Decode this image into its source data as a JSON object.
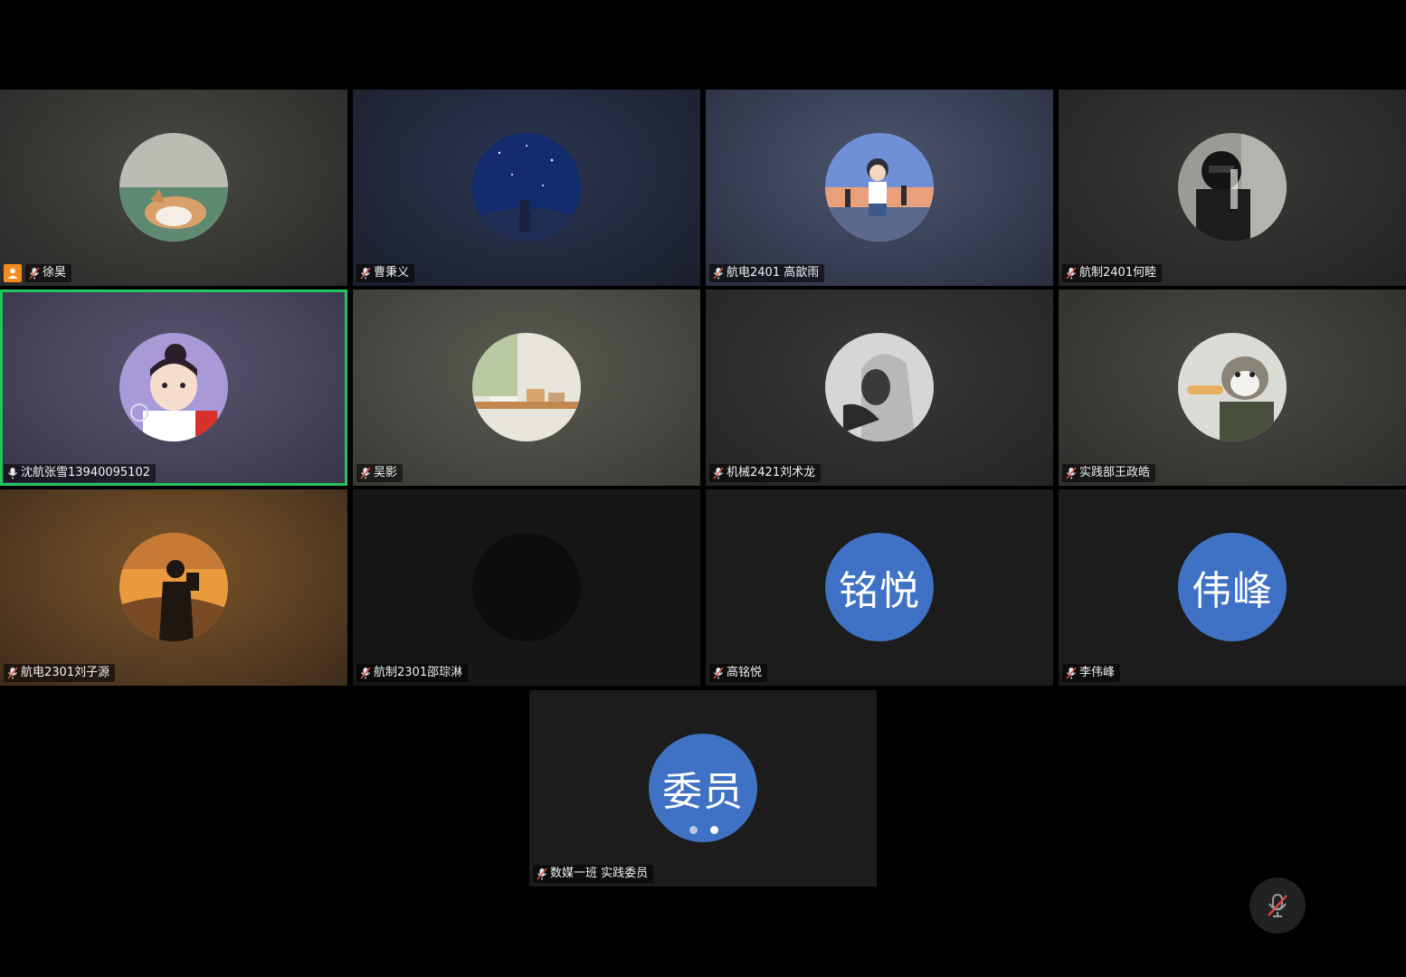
{
  "participants": [
    {
      "name": "徐昊",
      "host": true,
      "muted": true,
      "active": false
    },
    {
      "name": "曹秉义",
      "muted": true,
      "active": false
    },
    {
      "name": "航电2401 高歆雨",
      "muted": true,
      "active": false
    },
    {
      "name": "航制2401何睦",
      "muted": true,
      "active": false
    },
    {
      "name": "沈航张雪13940095102",
      "muted": false,
      "active": true
    },
    {
      "name": "吴影",
      "muted": true,
      "active": false
    },
    {
      "name": "机械2421刘术龙",
      "muted": true,
      "active": false
    },
    {
      "name": "实践部王政皓",
      "muted": true,
      "active": false
    },
    {
      "name": "航电2301刘子源",
      "muted": true,
      "active": false
    },
    {
      "name": "航制2301邵琮淋",
      "muted": true,
      "active": false
    },
    {
      "name": "高铭悦",
      "muted": true,
      "active": false,
      "initials": "铭悦"
    },
    {
      "name": "李伟峰",
      "muted": true,
      "active": false,
      "initials": "伟峰"
    },
    {
      "name": "数媒一班 实践委员",
      "muted": true,
      "active": false,
      "initials": "委员"
    }
  ],
  "colors": {
    "active_border": "#22c55e",
    "initials_bg": "#3f72c4",
    "host_badge": "#f28b1e",
    "muted_slash": "#e5483d"
  },
  "icons": {
    "host": "host-person-icon",
    "mic_muted": "mic-muted-icon",
    "mic_on": "mic-icon"
  }
}
